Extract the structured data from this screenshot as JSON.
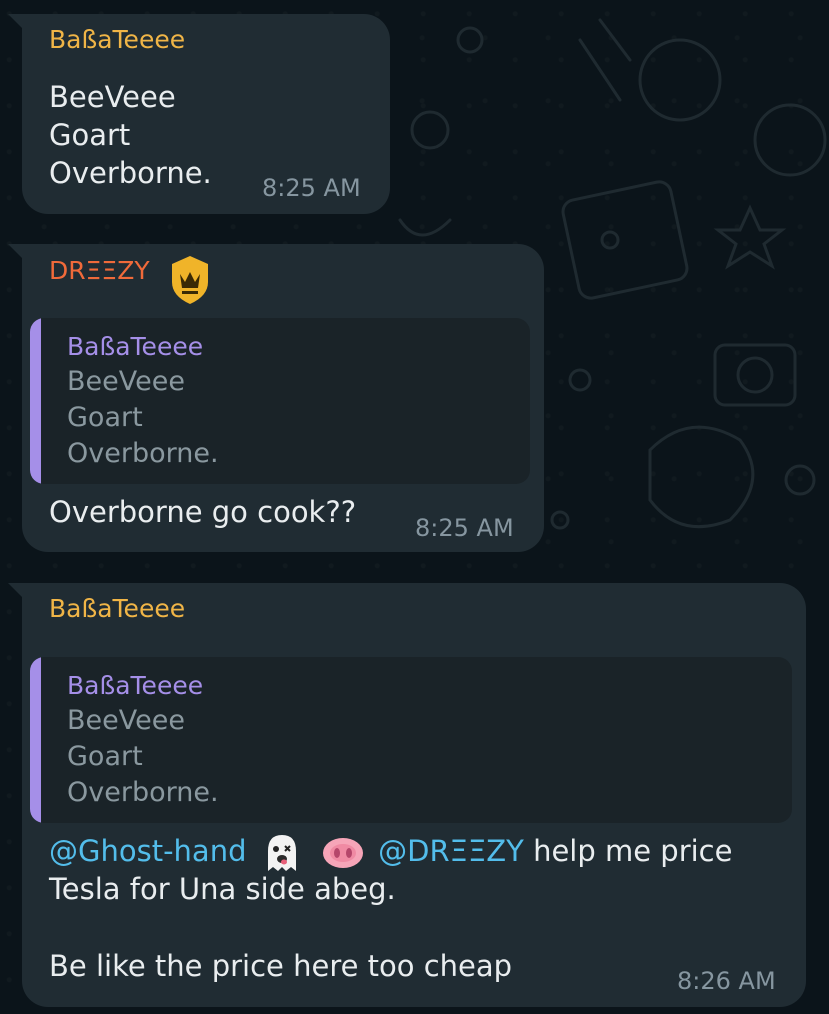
{
  "messages": [
    {
      "sender": "BaßaTeeee",
      "text": "BeeVeee\nGoart\nOverborne.",
      "time": "8:25 AM"
    },
    {
      "sender": "DRΞΞZY",
      "badge_icon": "crown-icon",
      "quote": {
        "sender": "BaßaTeeee",
        "text": "BeeVeee\nGoart\nOverborne."
      },
      "text": "Overborne go cook??",
      "time": "8:25 AM"
    },
    {
      "sender": "BaßaTeeee",
      "quote": {
        "sender": "BaßaTeeee",
        "text": "BeeVeee\nGoart\nOverborne."
      },
      "mention_1": "@Ghost-hand",
      "emoji_1": "ghost-emoji",
      "emoji_2": "pig-nose-emoji",
      "mention_2": "@DRΞΞZY",
      "text_line_1_rest": " help me price",
      "text_line_2": "Tesla for Una side abeg.",
      "text_line_3": "Be like the price here too cheap",
      "time": "8:26 AM"
    }
  ],
  "colors": {
    "background": "#0b141a",
    "bubble": "#202c33",
    "sender_gold": "#f0b547",
    "sender_orange": "#f06a3a",
    "quote_accent": "#a58fe8",
    "mention": "#53bdeb"
  }
}
